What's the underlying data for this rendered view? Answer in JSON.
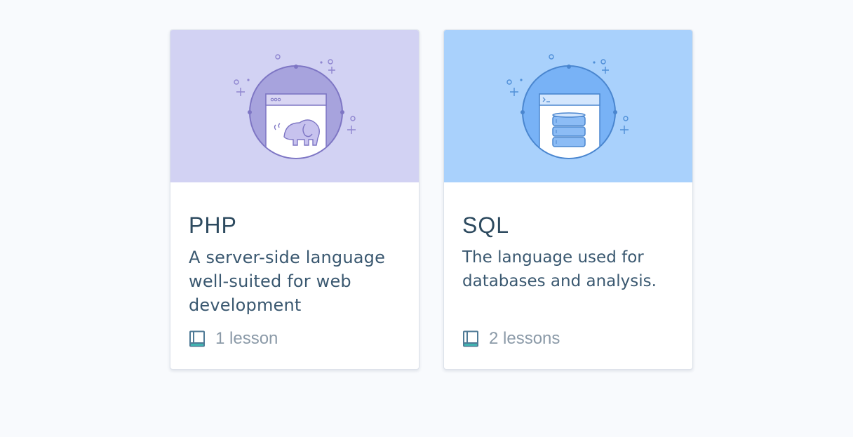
{
  "courses": [
    {
      "title": "PHP",
      "description": "A server-side language well-suited for web development",
      "lessons": "1 lesson",
      "icon": "elephant-icon",
      "banner_color": "#d2d2f3",
      "accent_color": "#a7a3dd"
    },
    {
      "title": "SQL",
      "description": "The language used for databases and analysis.",
      "lessons": "2 lessons",
      "icon": "database-icon",
      "banner_color": "#a9d1fc",
      "accent_color": "#78b2f6"
    }
  ]
}
